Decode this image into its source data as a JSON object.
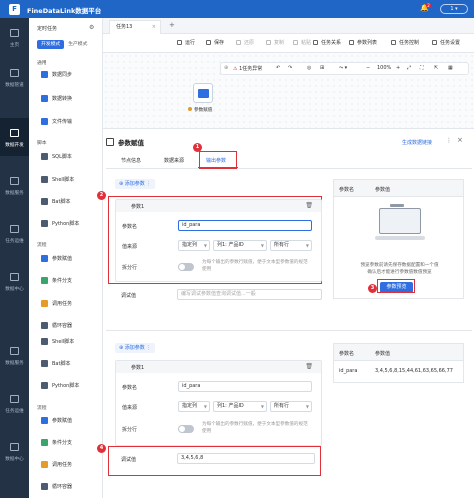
{
  "app": {
    "title": "FineDataLink数据平台",
    "logo": "F",
    "notif_count": "2",
    "user": "1"
  },
  "nav": [
    {
      "label": "主页",
      "icon": "home-icon"
    },
    {
      "label": "数据管道",
      "icon": "pipeline-icon"
    },
    {
      "label": "数据开发",
      "icon": "dev-icon"
    },
    {
      "label": "数据服务",
      "icon": "service-icon"
    },
    {
      "label": "任务运维",
      "icon": "ops-icon"
    },
    {
      "label": "数据中心",
      "icon": "center-icon"
    },
    {
      "label": "数据服务",
      "icon": "service-icon"
    },
    {
      "label": "任务运维",
      "icon": "ops-icon"
    },
    {
      "label": "数据中心",
      "icon": "center-icon"
    }
  ],
  "panel": {
    "header": "定时任务",
    "mode_dev": "开发模式",
    "mode_prod": "生产模式",
    "sections": [
      {
        "cat": "通用",
        "items": [
          "数据同步",
          "数据转换",
          "文件传输"
        ]
      },
      {
        "cat": "脚本",
        "items": [
          "SQL脚本",
          "Shell脚本",
          "Bat脚本",
          "Python脚本"
        ]
      },
      {
        "cat": "流程",
        "items": [
          "参数赋值",
          "条件分支",
          "调用任务",
          "循环容器"
        ]
      }
    ],
    "lower_items": [
      "Shell脚本",
      "Bat脚本",
      "Python脚本"
    ],
    "lower_cat": "流程",
    "lower_items2": [
      "参数赋值",
      "条件分支",
      "调用任务",
      "循环容器"
    ]
  },
  "tabs": {
    "active": "任务13"
  },
  "toolbar": [
    "运行",
    "保存",
    "还原",
    "复制",
    "粘贴",
    "任务关系",
    "参数列表",
    "任务控制",
    "任务设置"
  ],
  "canvas": {
    "error_chip": "1任务异常",
    "zoom": "100%",
    "node_label": "参数赋值"
  },
  "drawer": {
    "title": "参数赋值",
    "doc_link": "生成数据链接",
    "tabs": [
      "节点信息",
      "数据来源",
      "输出参数"
    ],
    "add_param": "添加参数",
    "card1": {
      "title": "参数1",
      "name_label": "参数名",
      "name_value": "id_para",
      "value_label": "值来源",
      "sel1": "指定列",
      "sel2": "列1: 产品ID",
      "sel3": "所有行",
      "split_label": "拆分行",
      "split_hint": "为每个输出的参数行赋值，便于文本型参数值的规范使用",
      "debug_label": "调试值",
      "debug_placeholder": "编写调试参数值查询调试值...一般"
    },
    "card2": {
      "title": "参数1",
      "name_label": "参数名",
      "name_value": "id_para",
      "value_label": "值来源",
      "sel1": "指定列",
      "sel2": "列1: 产品ID",
      "sel3": "所有行",
      "split_label": "拆分行",
      "split_hint": "为每个输出的参数行赋值，便于文本型参数值的规范使用",
      "debug_label": "调试值",
      "debug_value": "3,4,5,6,8"
    },
    "right1": {
      "col1": "参数名",
      "col2": "参数值",
      "empty_text": "预览参数前请先保存数据配置和一个值\n确认后才能进行参数值数值预览",
      "button": "参数预览"
    },
    "right2": {
      "col1": "参数名",
      "col2": "参数值",
      "row_name": "id_para",
      "row_value": "3,4,5,6,8,15,44,61,63,65,66,77"
    }
  },
  "annotations": [
    "1",
    "2",
    "3",
    "4"
  ],
  "colors": {
    "brand": "#1f66c7",
    "accent": "#2f6ee0",
    "highlight": "#e0303a",
    "nav_bg": "#233244"
  }
}
